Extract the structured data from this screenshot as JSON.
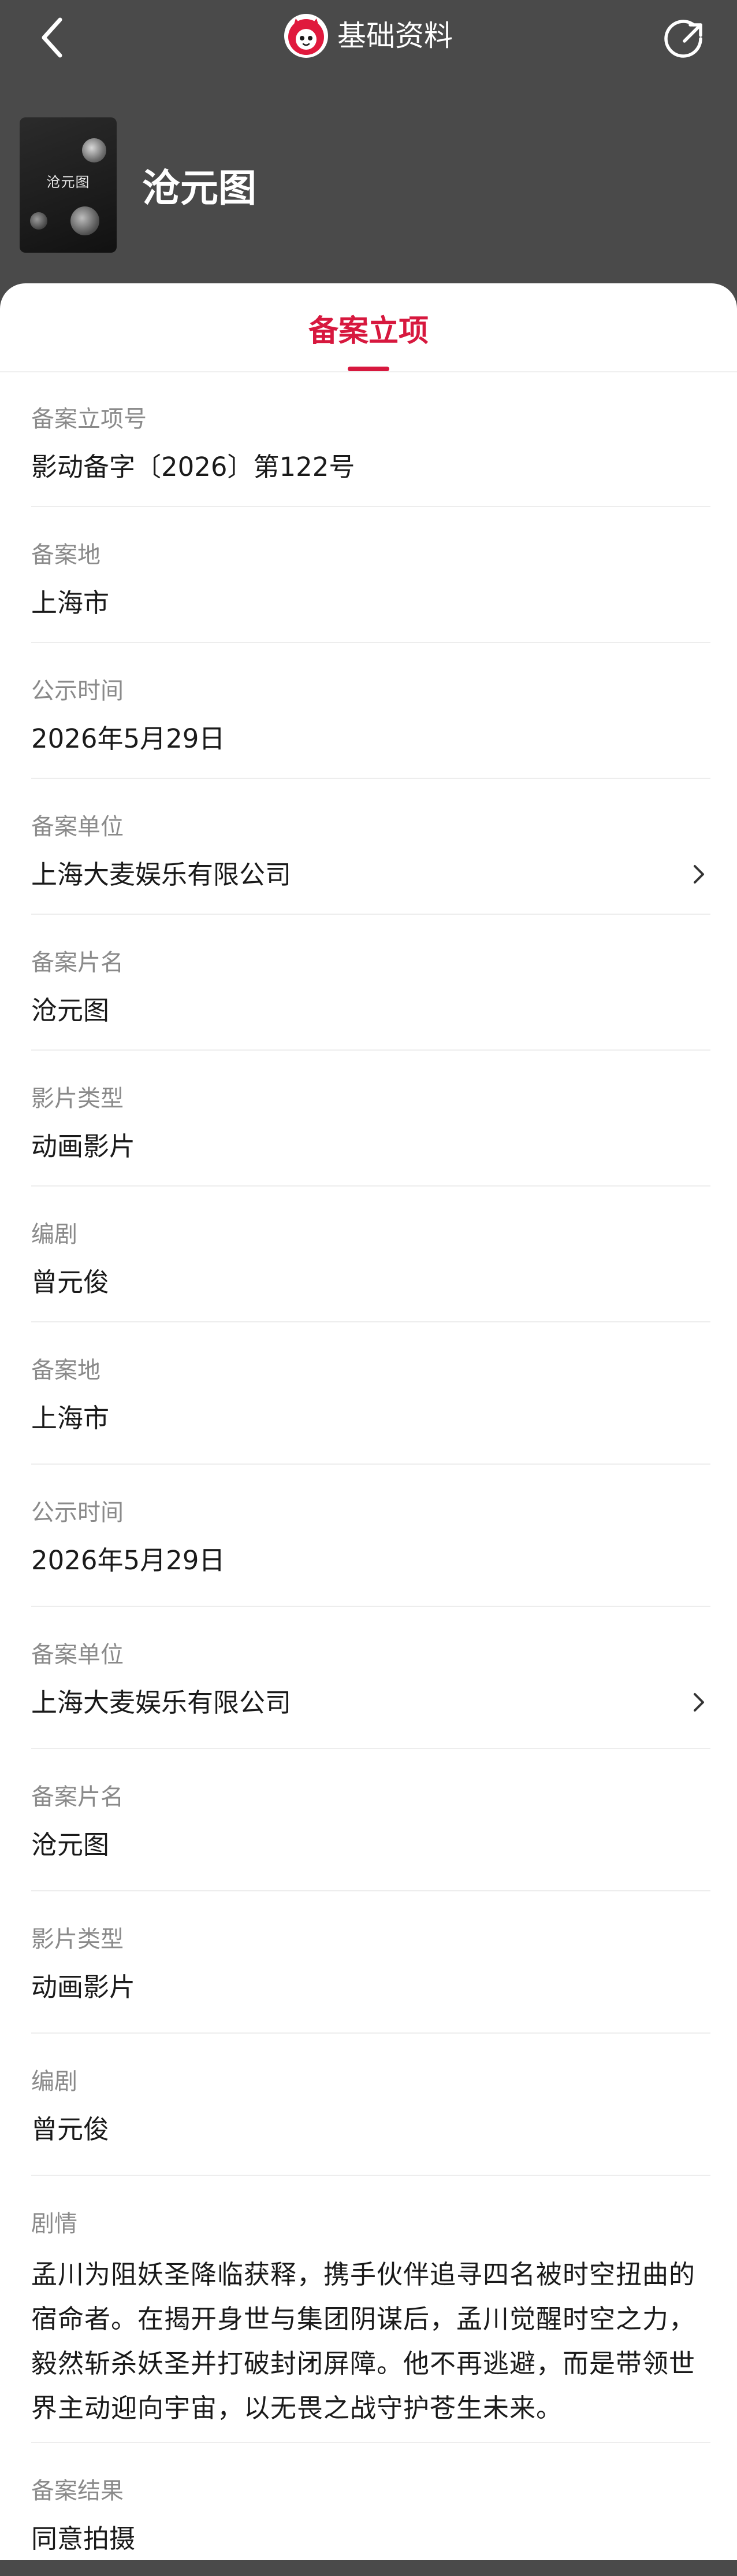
{
  "nav": {
    "title": "基础资料"
  },
  "movie": {
    "title": "沧元图",
    "poster_text": "沧元图"
  },
  "tabs": [
    {
      "label": "备案立项"
    }
  ],
  "rows": [
    {
      "label": "备案立项号",
      "value": "影动备字〔2026〕第122号"
    },
    {
      "label": "备案地",
      "value": "上海市"
    },
    {
      "label": "公示时间",
      "value": "2026年5月29日"
    },
    {
      "label": "备案单位",
      "value": "上海大麦娱乐有限公司"
    },
    {
      "label": "备案片名",
      "value": "沧元图"
    },
    {
      "label": "影片类型",
      "value": "动画影片"
    },
    {
      "label": "编剧",
      "value": "曾元俊"
    },
    {
      "label": "备案地",
      "value": "上海市"
    },
    {
      "label": "公示时间",
      "value": "2026年5月29日"
    },
    {
      "label": "备案单位",
      "value": "上海大麦娱乐有限公司"
    },
    {
      "label": "备案片名",
      "value": "沧元图"
    },
    {
      "label": "影片类型",
      "value": "动画影片"
    },
    {
      "label": "编剧",
      "value": "曾元俊"
    }
  ],
  "plot": {
    "label": "剧情",
    "text": "孟川为阻妖圣降临获释，携手伙伴追寻四名被时空扭曲的宿命者。在揭开身世与集团阴谋后，孟川觉醒时空之力，毅然斩杀妖圣并打破封闭屏障。他不再逃避，而是带领世界主动迎向宇宙，以无畏之战守护苍生未来。"
  },
  "result": {
    "label": "备案结果",
    "value": "同意拍摄"
  },
  "colors": {
    "accent": "#d7183e",
    "header_bg": "#4a4a4a",
    "label": "#8a8a8a",
    "text": "#1a1a1a"
  },
  "icons": {
    "back": "chevron-left-icon",
    "share": "share-icon",
    "logo": "cat-logo-icon",
    "row_arrow": "chevron-right-icon"
  }
}
